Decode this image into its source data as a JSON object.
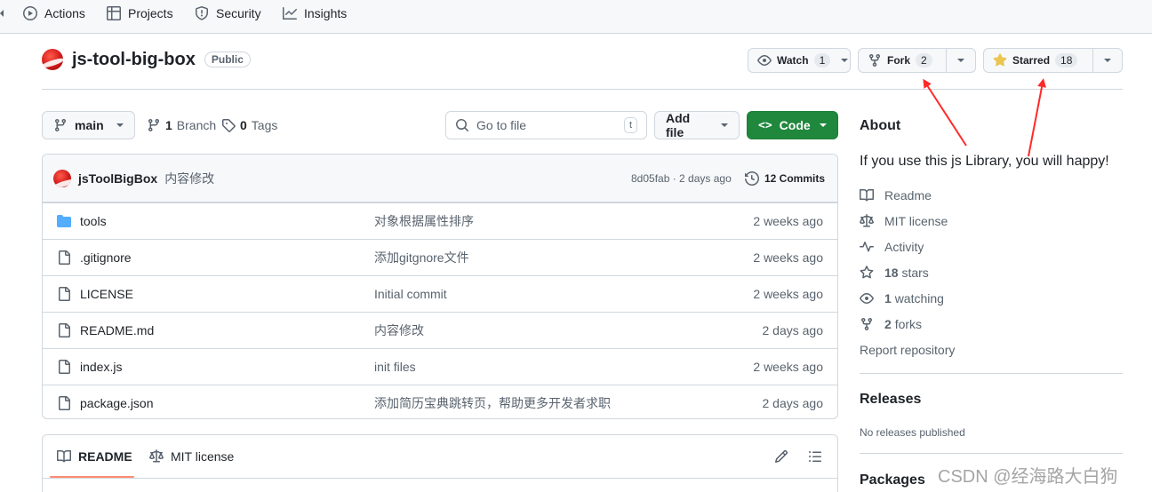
{
  "nav": {
    "tabs": [
      {
        "label": "Actions",
        "icon": "play-icon"
      },
      {
        "label": "Projects",
        "icon": "table-icon"
      },
      {
        "label": "Security",
        "icon": "shield-icon"
      },
      {
        "label": "Insights",
        "icon": "graph-icon"
      }
    ]
  },
  "repo": {
    "name": "js-tool-big-box",
    "visibility": "Public"
  },
  "actions": {
    "watch_label": "Watch",
    "watch_count": "1",
    "fork_label": "Fork",
    "fork_count": "2",
    "star_label": "Starred",
    "star_count": "18"
  },
  "toolbar": {
    "branch": "main",
    "branch_count": "1",
    "branch_label": "Branch",
    "tag_count": "0",
    "tag_label": "Tags",
    "goto_placeholder": "Go to file",
    "goto_kbd": "t",
    "add_file": "Add file",
    "code": "Code"
  },
  "commit": {
    "user": "jsToolBigBox",
    "message": "内容修改",
    "meta": "8d05fab · 2 days ago",
    "commits": "12 Commits"
  },
  "files": [
    {
      "name": "tools",
      "type": "folder",
      "message": "对象根据属性排序",
      "date": "2 weeks ago"
    },
    {
      "name": ".gitignore",
      "type": "file",
      "message": "添加gitgnore文件",
      "date": "2 weeks ago"
    },
    {
      "name": "LICENSE",
      "type": "file",
      "message": "Initial commit",
      "date": "2 weeks ago"
    },
    {
      "name": "README.md",
      "type": "file",
      "message": "内容修改",
      "date": "2 days ago"
    },
    {
      "name": "index.js",
      "type": "file",
      "message": "init files",
      "date": "2 weeks ago"
    },
    {
      "name": "package.json",
      "type": "file",
      "message": "添加简历宝典跳转页，帮助更多开发者求职",
      "date": "2 days ago"
    }
  ],
  "readme": {
    "tab_readme": "README",
    "tab_license": "MIT license"
  },
  "about": {
    "title": "About",
    "description": "If you use this js Library, you will happy!",
    "readme": "Readme",
    "license": "MIT license",
    "activity": "Activity",
    "stars_count": "18",
    "stars_label": "stars",
    "watching_count": "1",
    "watching_label": "watching",
    "forks_count": "2",
    "forks_label": "forks",
    "report": "Report repository"
  },
  "releases": {
    "title": "Releases",
    "empty": "No releases published"
  },
  "packages": {
    "title": "Packages"
  },
  "watermark": "CSDN @经海路大白狗",
  "colors": {
    "primary_green": "#1f883d",
    "annotation_red": "#ff2a2a",
    "folder_blue": "#54aeff"
  }
}
